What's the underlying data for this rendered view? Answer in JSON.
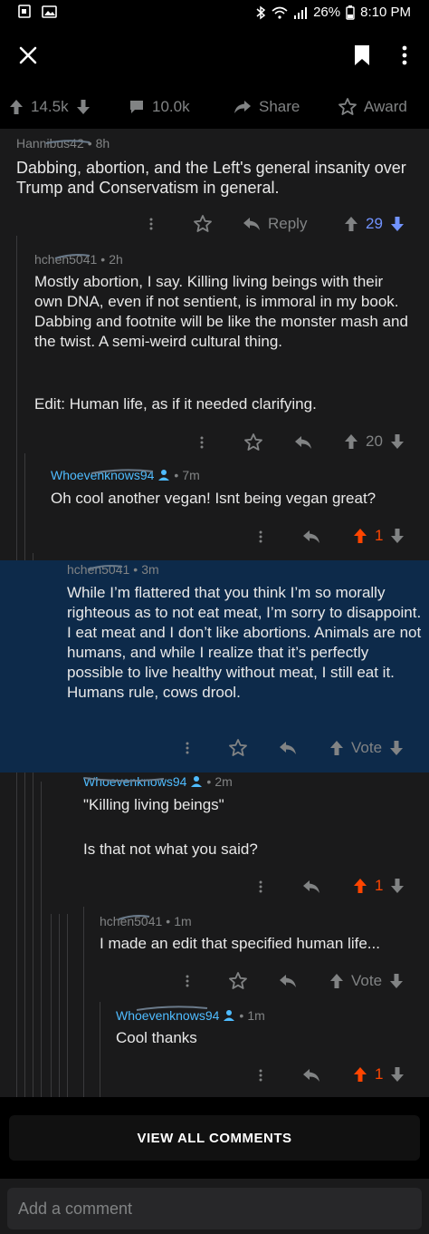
{
  "status_bar": {
    "battery": "26%",
    "time": "8:10 PM"
  },
  "post_actions": {
    "upvotes": "14.5k",
    "comments": "10.0k",
    "share": "Share",
    "award": "Award"
  },
  "comments": [
    {
      "author": "Hannibus42",
      "age": "8h",
      "text": "Dabbing, abortion, and the Left's general insanity over Trump and Conservatism in general.",
      "reply_label": "Reply",
      "score": "29",
      "vote_state": "down"
    },
    {
      "author": "hchen5041",
      "age": "2h",
      "text": "Mostly abortion, I say. Killing living beings with their own DNA, even if not sentient, is immoral in my book. Dabbing and footnite will be like the monster mash and the twist. A semi-weird cultural thing.",
      "edit": "Edit: Human life, as if it needed clarifying.",
      "score": "20"
    },
    {
      "author": "Whoevenknows94",
      "age": "7m",
      "text": "Oh cool another vegan! Isnt being vegan great?",
      "score": "1",
      "vote_state": "up"
    },
    {
      "author": "hchen5041",
      "age": "3m",
      "text": "While I’m flattered that you think I’m so morally righteous as to not eat meat, I’m sorry to disappoint. I eat meat and I don’t like abortions. Animals are not humans, and while I realize that it’s perfectly possible to live healthy without meat, I still eat it. Humans rule, cows drool.",
      "score": "Vote"
    },
    {
      "author": "Whoevenknows94",
      "age": "2m",
      "text": "\"Killing living beings\"",
      "text2": "Is that not what you said?",
      "score": "1",
      "vote_state": "up"
    },
    {
      "author": "hchen5041",
      "age": "1m",
      "text": "I made an edit that specified human life...",
      "score": "Vote"
    },
    {
      "author": "Whoevenknows94",
      "age": "1m",
      "text": "Cool thanks",
      "score": "1",
      "vote_state": "up"
    }
  ],
  "view_all": "VIEW ALL COMMENTS",
  "add_comment_placeholder": "Add a comment",
  "colors": {
    "background": "#1a1a1b",
    "highlight": "#0d2a4a",
    "upvote_orange": "#ff4500",
    "downvote_blue": "#7193ff",
    "op_blue": "#4fbcff"
  },
  "icons": [
    "close-icon",
    "bookmark-icon",
    "more-vertical-icon",
    "upvote-arrow-icon",
    "downvote-arrow-icon",
    "comment-bubble-icon",
    "share-arrow-icon",
    "award-icon",
    "reply-arrow-icon",
    "user-icon"
  ]
}
